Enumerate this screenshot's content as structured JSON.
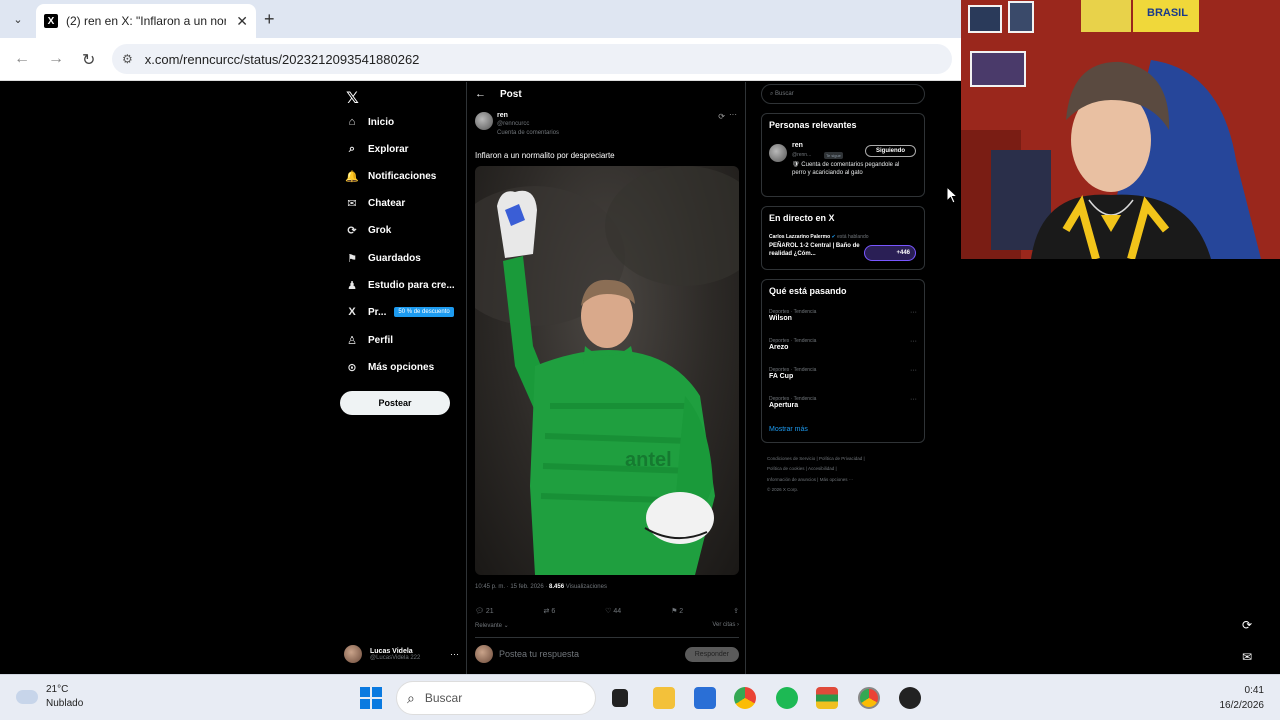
{
  "browser": {
    "tab": {
      "title": "(2) ren en X: \"Inflaron a un norm",
      "close": "✕",
      "new": "+"
    },
    "url": "x.com/renncurcc/status/2023212093541880262"
  },
  "nav": {
    "items": [
      {
        "label": "Inicio",
        "icon": "⌂"
      },
      {
        "label": "Explorar",
        "icon": "⌕"
      },
      {
        "label": "Notificaciones",
        "icon": "🔔"
      },
      {
        "label": "Chatear",
        "icon": "✉"
      },
      {
        "label": "Grok",
        "icon": "⟳"
      },
      {
        "label": "Guardados",
        "icon": "⚑"
      },
      {
        "label": "Estudio para cre...",
        "icon": "♟"
      },
      {
        "label": "Pr...",
        "icon": "X",
        "badge": "50 % de descuento"
      },
      {
        "label": "Perfil",
        "icon": "♙"
      },
      {
        "label": "Más opciones",
        "icon": "⊙"
      }
    ],
    "post_button": "Postear",
    "account": {
      "name": "Lucas Videla",
      "handle": "@LucasVidela 222",
      "more": "···"
    }
  },
  "post": {
    "header_title": "Post",
    "author_name": "ren",
    "author_handle": "@renncurcc",
    "community": "Cuenta de comentarios",
    "text": "Inflaron a un normalito por despreciarte",
    "meta_time": "10:45 p. m. · 15 feb. 2026 · ",
    "meta_views": "8.456",
    "meta_views_label": " Visualizaciones",
    "actions": {
      "replies": "21",
      "reposts": "6",
      "likes": "44",
      "bookmarks": "2"
    },
    "relevance": "Relevante ⌄",
    "quotes": "Ver citas ›",
    "reply_placeholder": "Postea tu respuesta",
    "reply_button": "Responder"
  },
  "sidebar": {
    "search_placeholder": "Buscar",
    "relevant": {
      "title": "Personas relevantes",
      "name": "ren",
      "handle": "@renn...",
      "follows_you": "Te sigue",
      "follow_btn": "Siguiendo",
      "bio": "🛡 Cuenta de comentarios pegandole al perro y acariciando al gato"
    },
    "live": {
      "title": "En directo en X",
      "host": "Carlos Lazzarino Palermo",
      "host_status": " está hablando",
      "stream_title": "PEÑAROL 1-2 Central | Baño de realidad ¿Cóm...",
      "count": "+446"
    },
    "trends": {
      "title": "Qué está pasando",
      "items": [
        {
          "category": "Deportes · Tendencia",
          "name": "Wilson"
        },
        {
          "category": "Deportes · Tendencia",
          "name": "Arezo"
        },
        {
          "category": "Deportes · Tendencia",
          "name": "FA Cup"
        },
        {
          "category": "Deportes · Tendencia",
          "name": "Apertura"
        }
      ],
      "show_more": "Mostrar más"
    },
    "footer": [
      "Condiciones de Servicio",
      "Política de Privacidad",
      "Política de cookies",
      "Accesibilidad",
      "Información de anuncios",
      "Más opciones ···",
      "© 2026 X Corp."
    ]
  },
  "taskbar": {
    "temp": "21°C",
    "weather": "Nublado",
    "search": "Buscar",
    "time": "0:41",
    "date": "16/2/2026"
  }
}
